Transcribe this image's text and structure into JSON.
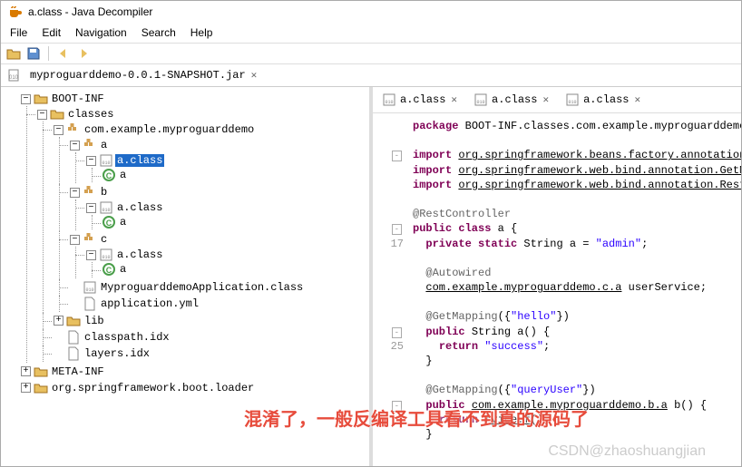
{
  "window": {
    "title": "a.class - Java Decompiler"
  },
  "menu": [
    "File",
    "Edit",
    "Navigation",
    "Search",
    "Help"
  ],
  "open_file": "myproguarddemo-0.0.1-SNAPSHOT.jar",
  "tree": {
    "root": [
      {
        "name": "BOOT-INF",
        "expanded": true,
        "children": [
          {
            "name": "classes",
            "expanded": true,
            "children": [
              {
                "name": "com.example.myproguarddemo",
                "expanded": true,
                "children": [
                  {
                    "name": "a",
                    "expanded": true,
                    "children": [
                      {
                        "name": "a.class",
                        "selected": true,
                        "expanded": true,
                        "children": [
                          {
                            "name": "a",
                            "leaf_g": true
                          }
                        ]
                      }
                    ]
                  },
                  {
                    "name": "b",
                    "expanded": true,
                    "children": [
                      {
                        "name": "a.class",
                        "expanded": true,
                        "children": [
                          {
                            "name": "a",
                            "leaf_g": true
                          }
                        ]
                      }
                    ]
                  },
                  {
                    "name": "c",
                    "expanded": true,
                    "children": [
                      {
                        "name": "a.class",
                        "expanded": true,
                        "children": [
                          {
                            "name": "a",
                            "leaf_g": true
                          }
                        ]
                      }
                    ]
                  },
                  {
                    "name": "MyproguarddemoApplication.class"
                  },
                  {
                    "name": "application.yml"
                  }
                ]
              },
              {
                "name": "lib",
                "collapsed": true
              },
              {
                "name": "classpath.idx"
              },
              {
                "name": "layers.idx"
              }
            ]
          }
        ]
      },
      {
        "name": "META-INF",
        "collapsed": true
      },
      {
        "name": "org.springframework.boot.loader",
        "collapsed": true
      }
    ]
  },
  "code_tabs": [
    "a.class",
    "a.class",
    "a.class"
  ],
  "source": {
    "lines": [
      {
        "t": "package BOOT-INF.classes.com.example.myproguarddemo.a;",
        "parts": [
          {
            "k": "package",
            "kw": true
          },
          {
            "k": " BOOT-INF.classes.com.example.myproguarddemo.a;"
          }
        ]
      },
      {
        "t": ""
      },
      {
        "t": "import org.springframework.beans.factory.annotation.Aut",
        "parts": [
          {
            "k": "import",
            "kw": true
          },
          {
            "k": " "
          },
          {
            "k": "org.springframework.beans.factory.annotation.Auto",
            "u": true
          }
        ],
        "fold": "-"
      },
      {
        "t": "import org.springframework.web.bind.annotation.GetMappi",
        "parts": [
          {
            "k": "import",
            "kw": true
          },
          {
            "k": " "
          },
          {
            "k": "org.springframework.web.bind.annotation.GetMappi",
            "u": true
          }
        ]
      },
      {
        "t": "import org.springframework.web.bind.annotation.RestCont",
        "parts": [
          {
            "k": "import",
            "kw": true
          },
          {
            "k": " "
          },
          {
            "k": "org.springframework.web.bind.annotation.RestContr",
            "u": true
          }
        ]
      },
      {
        "t": ""
      },
      {
        "t": "@RestController",
        "ann": true
      },
      {
        "t": "public class a {",
        "parts": [
          {
            "k": "public class",
            "kw": true
          },
          {
            "k": " a {"
          }
        ],
        "fold": "-"
      },
      {
        "n": 17,
        "t": "  private static String a = \"admin\";",
        "parts": [
          {
            "k": "  "
          },
          {
            "k": "private static",
            "kw": true
          },
          {
            "k": " String a = "
          },
          {
            "k": "\"admin\"",
            "str": true
          },
          {
            "k": ";"
          }
        ]
      },
      {
        "t": ""
      },
      {
        "t": "  @Autowired",
        "ann": true
      },
      {
        "t": "  com.example.myproguarddemo.c.a userService;",
        "parts": [
          {
            "k": "  "
          },
          {
            "k": "com.example.myproguarddemo.c.a",
            "u": true
          },
          {
            "k": " userService;"
          }
        ]
      },
      {
        "t": ""
      },
      {
        "t": "  @GetMapping({\"hello\"})",
        "parts": [
          {
            "k": "  "
          },
          {
            "k": "@GetMapping",
            "ann": true
          },
          {
            "k": "({"
          },
          {
            "k": "\"hello\"",
            "str": true
          },
          {
            "k": "})"
          }
        ]
      },
      {
        "t": "  public String a() {",
        "parts": [
          {
            "k": "  "
          },
          {
            "k": "public",
            "kw": true
          },
          {
            "k": " String a() {"
          }
        ],
        "fold": "-"
      },
      {
        "n": 25,
        "t": "    return \"success\";",
        "parts": [
          {
            "k": "    "
          },
          {
            "k": "return",
            "kw": true
          },
          {
            "k": " "
          },
          {
            "k": "\"success\"",
            "str": true
          },
          {
            "k": ";"
          }
        ]
      },
      {
        "t": "  }"
      },
      {
        "t": ""
      },
      {
        "t": "  @GetMapping({\"queryUser\"})",
        "parts": [
          {
            "k": "  "
          },
          {
            "k": "@GetMapping",
            "ann": true
          },
          {
            "k": "({"
          },
          {
            "k": "\"queryUser\"",
            "str": true
          },
          {
            "k": "})"
          }
        ]
      },
      {
        "t": "  public com.example.myproguarddemo.b.a b() {",
        "parts": [
          {
            "k": "  "
          },
          {
            "k": "public",
            "kw": true
          },
          {
            "k": " "
          },
          {
            "k": "com.example.myproguarddemo.b.a",
            "u": true
          },
          {
            "k": " b() {"
          }
        ],
        "fold": "-"
      },
      {
        "t": "    return rvice.f();",
        "parts": [
          {
            "k": "    "
          },
          {
            "k": "return",
            "kw": true
          },
          {
            "k": " "
          },
          {
            "k": "rvice.f",
            "u": true
          },
          {
            "k": "();"
          }
        ]
      },
      {
        "t": "  }"
      }
    ]
  },
  "overlay": "混淆了，一般反编译工具看不到真的源码了",
  "watermark": "CSDN@zhaoshuangjian"
}
